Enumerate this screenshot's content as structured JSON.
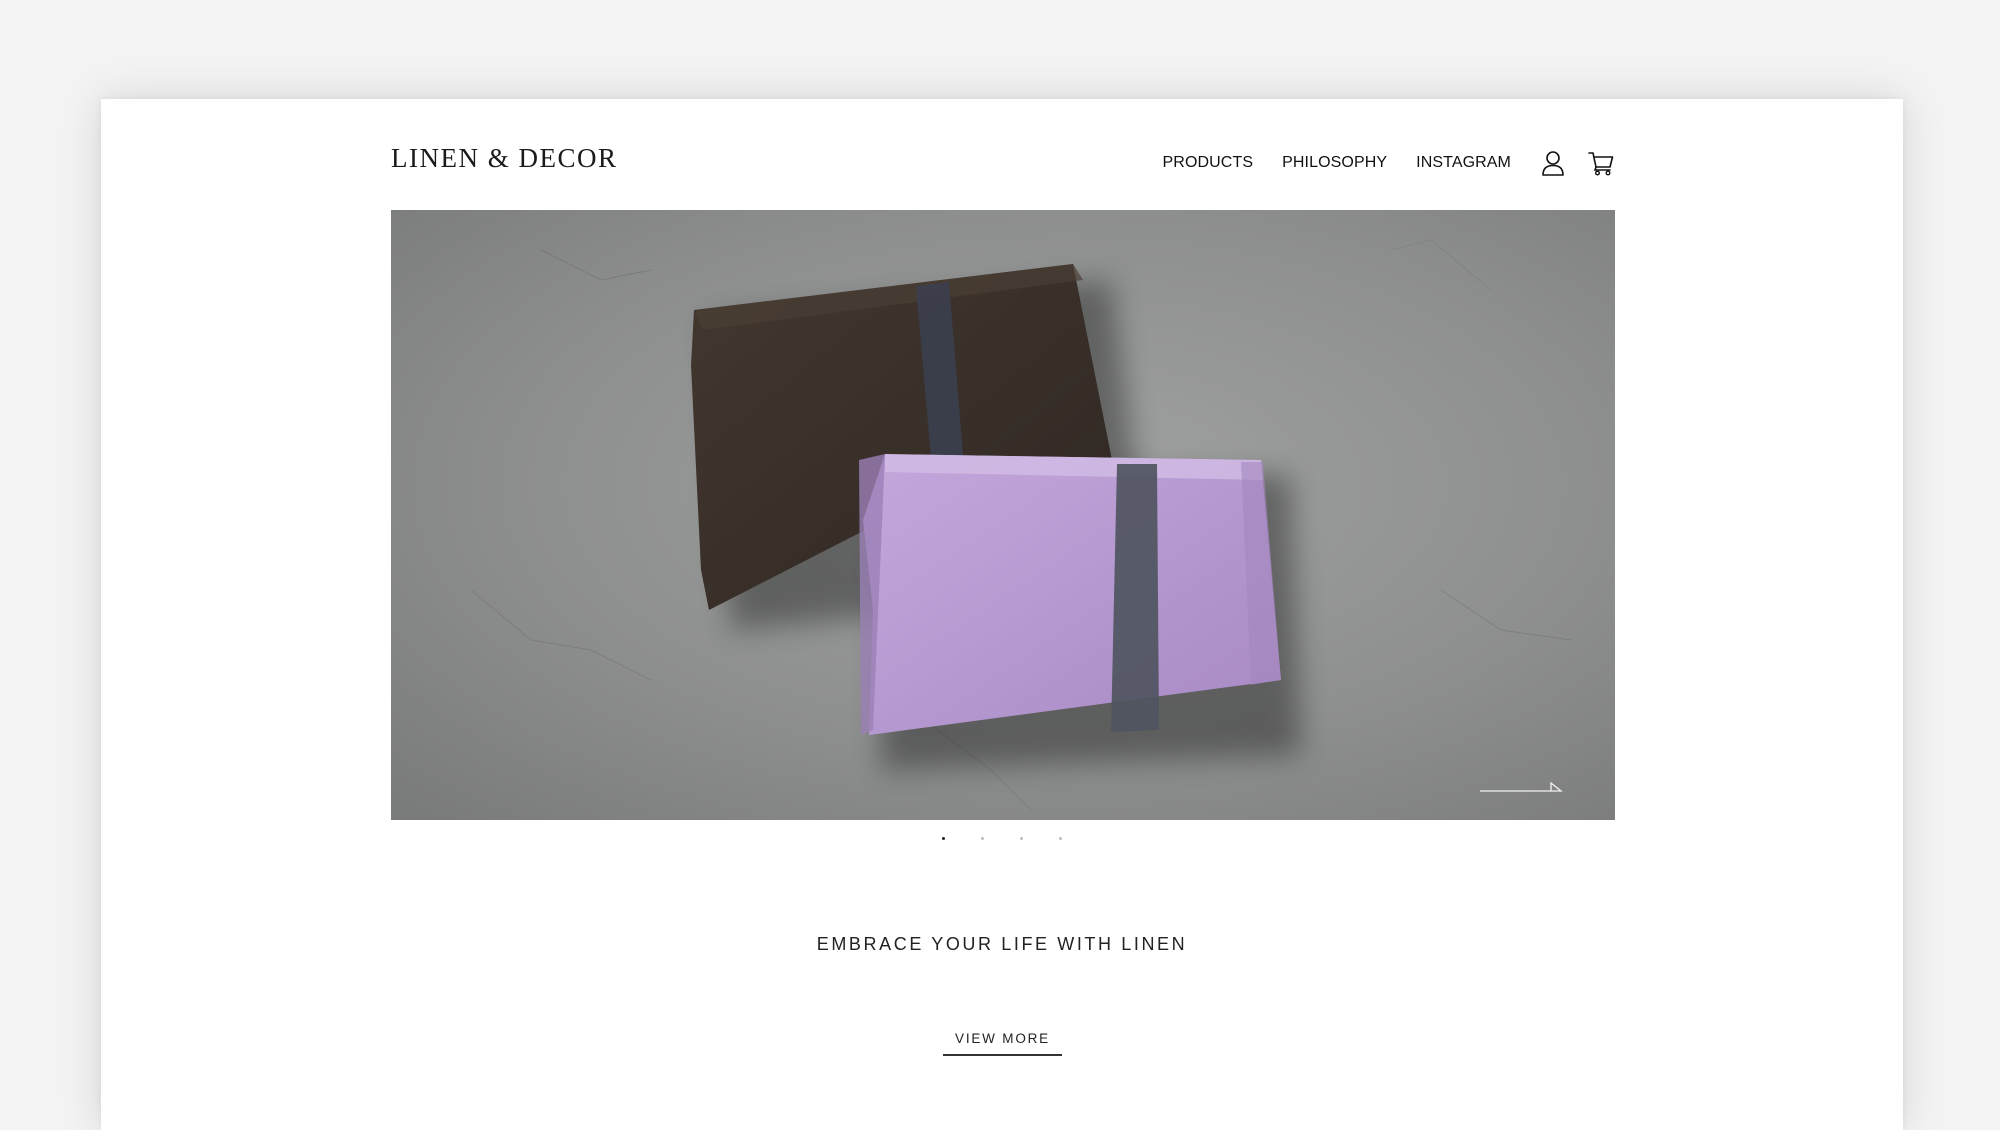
{
  "header": {
    "logo_text": "LINEN & DECOR",
    "nav": [
      {
        "label": "PRODUCTS"
      },
      {
        "label": "PHILOSOPHY"
      },
      {
        "label": "INSTAGRAM"
      }
    ],
    "icons": [
      "user-icon",
      "cart-icon"
    ]
  },
  "hero": {
    "image": "folded-linen-napkins-on-concrete",
    "next_icon": "arrow-right-icon",
    "colors": {
      "concrete": "#8f9090",
      "dark_napkin": "#3b322d",
      "lavender_napkin": "#b79bd0",
      "stripe": "#4f5560"
    }
  },
  "carousel": {
    "slide_count": 4,
    "active_index": 0
  },
  "main": {
    "tagline": "EMBRACE YOUR LIFE WITH LINEN",
    "cta_label": "VIEW MORE"
  }
}
